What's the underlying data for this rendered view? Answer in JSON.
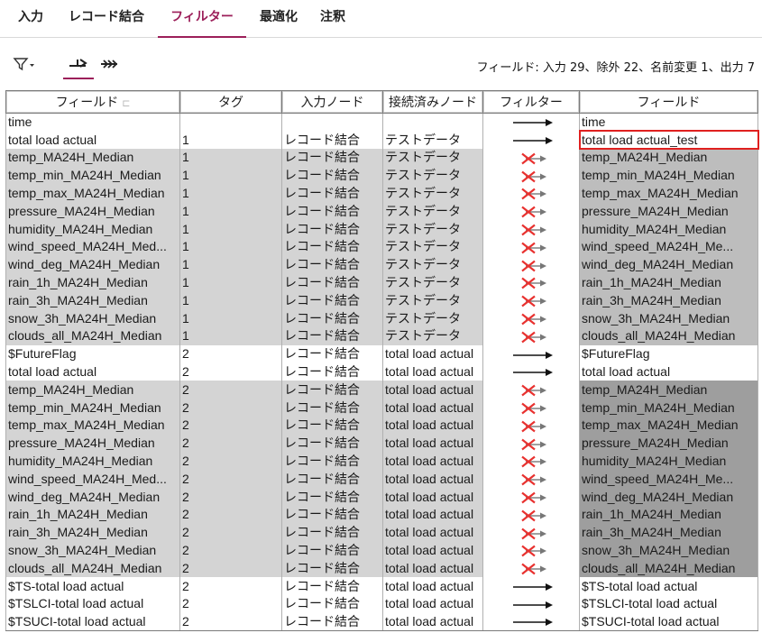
{
  "tabs": [
    {
      "label": "入力",
      "active": false
    },
    {
      "label": "レコード結合",
      "active": false
    },
    {
      "label": "フィルター",
      "active": true
    },
    {
      "label": "最適化",
      "active": false
    },
    {
      "label": "注釈",
      "active": false
    }
  ],
  "toolbar": {
    "filter_menu_icon": "filter-dropdown-icon",
    "view_icon_1": "flow-arrow-icon",
    "view_icon_2": "multi-arrow-icon",
    "summary": "フィールド: 入力 29、除外 22、名前変更 1、出力 7"
  },
  "colors": {
    "accent": "#9c1f5a",
    "highlight_box": "#e0201f",
    "excluded_row": "#d4d4d4",
    "excluded_out": "#bdbdbd",
    "excluded_out_dark": "#9e9e9e",
    "cross": "#e8312f"
  },
  "table": {
    "headers": [
      "フィールド",
      "タグ",
      "入力ノード",
      "接続済みノード",
      "フィルター",
      "フィールド"
    ],
    "rows": [
      {
        "field": "time",
        "tag": "",
        "in": "",
        "conn": "",
        "filter": "pass",
        "out": "time",
        "excluded": false,
        "group": 1
      },
      {
        "field": "total load actual",
        "tag": "1",
        "in": "レコード結合",
        "conn": "テストデータ",
        "filter": "pass",
        "out": "total load actual_test",
        "excluded": false,
        "group": 1,
        "highlight": true
      },
      {
        "field": "temp_MA24H_Median",
        "tag": "1",
        "in": "レコード結合",
        "conn": "テストデータ",
        "filter": "block",
        "out": "temp_MA24H_Median",
        "excluded": true,
        "group": 1
      },
      {
        "field": "temp_min_MA24H_Median",
        "tag": "1",
        "in": "レコード結合",
        "conn": "テストデータ",
        "filter": "block",
        "out": "temp_min_MA24H_Median",
        "excluded": true,
        "group": 1
      },
      {
        "field": "temp_max_MA24H_Median",
        "tag": "1",
        "in": "レコード結合",
        "conn": "テストデータ",
        "filter": "block",
        "out": "temp_max_MA24H_Median",
        "excluded": true,
        "group": 1
      },
      {
        "field": "pressure_MA24H_Median",
        "tag": "1",
        "in": "レコード結合",
        "conn": "テストデータ",
        "filter": "block",
        "out": "pressure_MA24H_Median",
        "excluded": true,
        "group": 1
      },
      {
        "field": "humidity_MA24H_Median",
        "tag": "1",
        "in": "レコード結合",
        "conn": "テストデータ",
        "filter": "block",
        "out": "humidity_MA24H_Median",
        "excluded": true,
        "group": 1
      },
      {
        "field": "wind_speed_MA24H_Med...",
        "tag": "1",
        "in": "レコード結合",
        "conn": "テストデータ",
        "filter": "block",
        "out": "wind_speed_MA24H_Me...",
        "excluded": true,
        "group": 1
      },
      {
        "field": "wind_deg_MA24H_Median",
        "tag": "1",
        "in": "レコード結合",
        "conn": "テストデータ",
        "filter": "block",
        "out": "wind_deg_MA24H_Median",
        "excluded": true,
        "group": 1
      },
      {
        "field": "rain_1h_MA24H_Median",
        "tag": "1",
        "in": "レコード結合",
        "conn": "テストデータ",
        "filter": "block",
        "out": "rain_1h_MA24H_Median",
        "excluded": true,
        "group": 1
      },
      {
        "field": "rain_3h_MA24H_Median",
        "tag": "1",
        "in": "レコード結合",
        "conn": "テストデータ",
        "filter": "block",
        "out": "rain_3h_MA24H_Median",
        "excluded": true,
        "group": 1
      },
      {
        "field": "snow_3h_MA24H_Median",
        "tag": "1",
        "in": "レコード結合",
        "conn": "テストデータ",
        "filter": "block",
        "out": "snow_3h_MA24H_Median",
        "excluded": true,
        "group": 1
      },
      {
        "field": "clouds_all_MA24H_Median",
        "tag": "1",
        "in": "レコード結合",
        "conn": "テストデータ",
        "filter": "block",
        "out": "clouds_all_MA24H_Median",
        "excluded": true,
        "group": 1
      },
      {
        "field": "$FutureFlag",
        "tag": "2",
        "in": "レコード結合",
        "conn": "total load actual",
        "filter": "pass",
        "out": "$FutureFlag",
        "excluded": false,
        "group": 2
      },
      {
        "field": "total load actual",
        "tag": "2",
        "in": "レコード結合",
        "conn": "total load actual",
        "filter": "pass",
        "out": "total load actual",
        "excluded": false,
        "group": 2
      },
      {
        "field": "temp_MA24H_Median",
        "tag": "2",
        "in": "レコード結合",
        "conn": "total load actual",
        "filter": "block",
        "out": "temp_MA24H_Median",
        "excluded": true,
        "group": 2
      },
      {
        "field": "temp_min_MA24H_Median",
        "tag": "2",
        "in": "レコード結合",
        "conn": "total load actual",
        "filter": "block",
        "out": "temp_min_MA24H_Median",
        "excluded": true,
        "group": 2
      },
      {
        "field": "temp_max_MA24H_Median",
        "tag": "2",
        "in": "レコード結合",
        "conn": "total load actual",
        "filter": "block",
        "out": "temp_max_MA24H_Median",
        "excluded": true,
        "group": 2
      },
      {
        "field": "pressure_MA24H_Median",
        "tag": "2",
        "in": "レコード結合",
        "conn": "total load actual",
        "filter": "block",
        "out": "pressure_MA24H_Median",
        "excluded": true,
        "group": 2
      },
      {
        "field": "humidity_MA24H_Median",
        "tag": "2",
        "in": "レコード結合",
        "conn": "total load actual",
        "filter": "block",
        "out": "humidity_MA24H_Median",
        "excluded": true,
        "group": 2
      },
      {
        "field": "wind_speed_MA24H_Med...",
        "tag": "2",
        "in": "レコード結合",
        "conn": "total load actual",
        "filter": "block",
        "out": "wind_speed_MA24H_Me...",
        "excluded": true,
        "group": 2
      },
      {
        "field": "wind_deg_MA24H_Median",
        "tag": "2",
        "in": "レコード結合",
        "conn": "total load actual",
        "filter": "block",
        "out": "wind_deg_MA24H_Median",
        "excluded": true,
        "group": 2
      },
      {
        "field": "rain_1h_MA24H_Median",
        "tag": "2",
        "in": "レコード結合",
        "conn": "total load actual",
        "filter": "block",
        "out": "rain_1h_MA24H_Median",
        "excluded": true,
        "group": 2
      },
      {
        "field": "rain_3h_MA24H_Median",
        "tag": "2",
        "in": "レコード結合",
        "conn": "total load actual",
        "filter": "block",
        "out": "rain_3h_MA24H_Median",
        "excluded": true,
        "group": 2
      },
      {
        "field": "snow_3h_MA24H_Median",
        "tag": "2",
        "in": "レコード結合",
        "conn": "total load actual",
        "filter": "block",
        "out": "snow_3h_MA24H_Median",
        "excluded": true,
        "group": 2
      },
      {
        "field": "clouds_all_MA24H_Median",
        "tag": "2",
        "in": "レコード結合",
        "conn": "total load actual",
        "filter": "block",
        "out": "clouds_all_MA24H_Median",
        "excluded": true,
        "group": 2
      },
      {
        "field": "$TS-total load actual",
        "tag": "2",
        "in": "レコード結合",
        "conn": "total load actual",
        "filter": "pass",
        "out": "$TS-total load actual",
        "excluded": false,
        "group": 2
      },
      {
        "field": "$TSLCI-total load actual",
        "tag": "2",
        "in": "レコード結合",
        "conn": "total load actual",
        "filter": "pass",
        "out": "$TSLCI-total load actual",
        "excluded": false,
        "group": 2
      },
      {
        "field": "$TSUCI-total load actual",
        "tag": "2",
        "in": "レコード結合",
        "conn": "total load actual",
        "filter": "pass",
        "out": "$TSUCI-total load actual",
        "excluded": false,
        "group": 2
      }
    ]
  }
}
